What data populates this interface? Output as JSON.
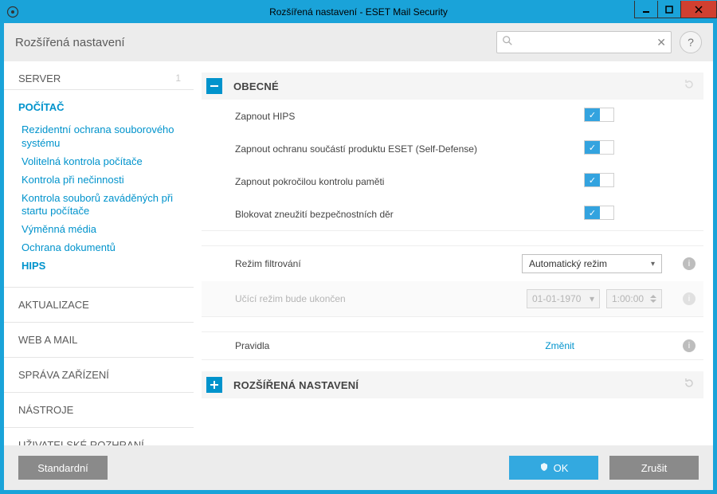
{
  "window": {
    "title": "Rozšířená nastavení - ESET Mail Security"
  },
  "toolbar": {
    "title": "Rozšířená nastavení",
    "search_placeholder": ""
  },
  "sidebar": {
    "server": {
      "label": "SERVER",
      "badge": "1"
    },
    "active": {
      "label": "POČÍTAČ"
    },
    "items": [
      {
        "label": "Rezidentní ochrana souborového systému"
      },
      {
        "label": "Volitelná kontrola počítače"
      },
      {
        "label": "Kontrola při nečinnosti"
      },
      {
        "label": "Kontrola souborů zaváděných při startu počítače"
      },
      {
        "label": "Výměnná média"
      },
      {
        "label": "Ochrana dokumentů"
      },
      {
        "label": "HIPS"
      }
    ],
    "cats": [
      {
        "label": "AKTUALIZACE"
      },
      {
        "label": "WEB A MAIL"
      },
      {
        "label": "SPRÁVA ZAŘÍZENÍ"
      },
      {
        "label": "NÁSTROJE"
      },
      {
        "label": "UŽIVATELSKÉ ROZHRANÍ"
      }
    ]
  },
  "sections": {
    "general": {
      "title": "OBECNÉ",
      "rows": {
        "enable_hips": "Zapnout HIPS",
        "self_defense": "Zapnout ochranu součástí produktu ESET (Self-Defense)",
        "adv_mem": "Zapnout pokročilou kontrolu paměti",
        "block_exploit": "Blokovat zneužití bezpečnostních děr",
        "filter_mode": "Režim filtrování",
        "filter_mode_value": "Automatický režim",
        "learning_ends": "Učící režim bude ukončen",
        "learning_date": "01-01-1970",
        "learning_time": "1:00:00",
        "rules": "Pravidla",
        "rules_action": "Změnit"
      }
    },
    "advanced": {
      "title": "ROZŠÍŘENÁ NASTAVENÍ"
    }
  },
  "footer": {
    "default": "Standardní",
    "ok": "OK",
    "cancel": "Zrušit"
  }
}
